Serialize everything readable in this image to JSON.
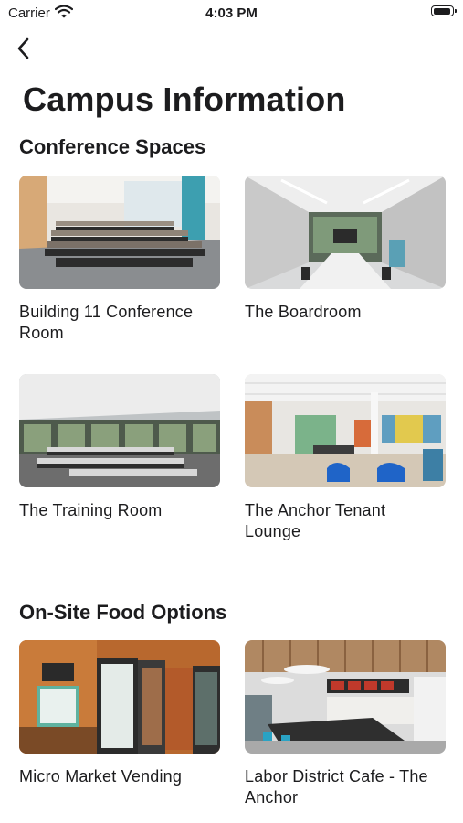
{
  "status_bar": {
    "carrier": "Carrier",
    "time": "4:03 PM"
  },
  "nav": {
    "back_icon": "chevron-left-icon"
  },
  "page_title": "Campus Information",
  "sections": [
    {
      "title": "Conference Spaces",
      "items": [
        {
          "label": "Building 11 Conference Room"
        },
        {
          "label": "The Boardroom"
        },
        {
          "label": "The Training Room"
        },
        {
          "label": "The Anchor Tenant Lounge"
        }
      ]
    },
    {
      "title": "On-Site Food Options",
      "items": [
        {
          "label": "Micro Market Vending"
        },
        {
          "label": "Labor District Cafe - The Anchor"
        }
      ]
    }
  ]
}
